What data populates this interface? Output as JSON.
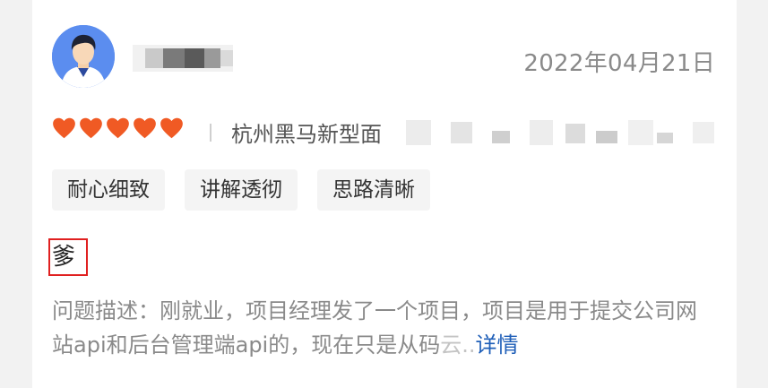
{
  "review": {
    "date": "2022年04月21日",
    "rating": 5,
    "course_name": "杭州黑马新型面",
    "tags": [
      "耐心细致",
      "讲解透彻",
      "思路清晰"
    ],
    "title": "爹",
    "description_prefix": "问题描述：刚就业，项目经理发了一个项目，项目是用于提交公司网站api和后台管理端api的，现在只是从码",
    "description_fade": "云..",
    "more_label": "详情"
  },
  "colors": {
    "heart": "#f05a24",
    "link": "#1f5fb8",
    "highlight_border": "#e02020",
    "avatar_bg": "#5b8def"
  },
  "icons": {
    "avatar": "user-avatar-icon",
    "rating": "heart-icon"
  }
}
